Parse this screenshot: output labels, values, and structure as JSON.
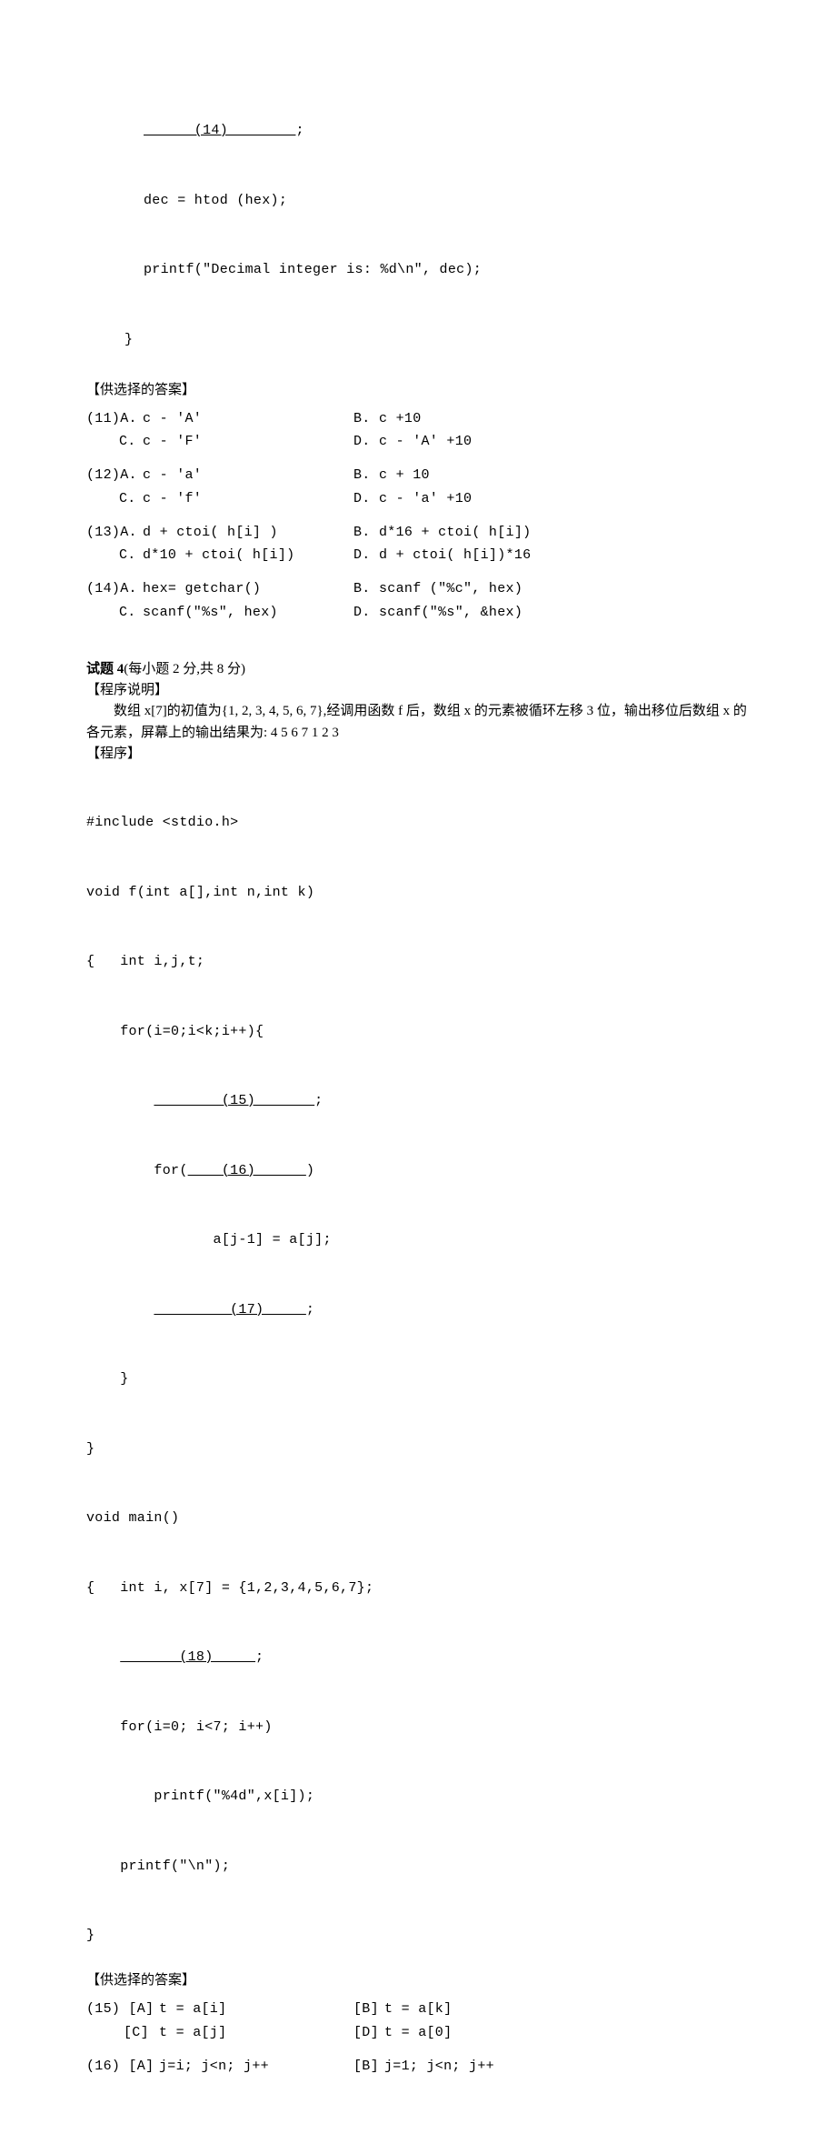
{
  "code_top": {
    "blank14": "      (14)        ",
    "blank14_semi": ";",
    "l2": "dec = htod (hex);",
    "l3": "printf(\"Decimal integer is: %d\\n\", dec);",
    "l4": "}"
  },
  "hdr_answers_top": "【供选择的答案】",
  "ans11": {
    "a_lbl": "(11)A.",
    "a": "c - 'A'",
    "b_lbl": "B.",
    "b": "c +10",
    "c_lbl": "C.",
    "c": "c - 'F'",
    "d_lbl": "D.",
    "d": "c - 'A'  +10"
  },
  "ans12": {
    "a_lbl": "(12)A.",
    "a": "c  - 'a'",
    "b_lbl": "B.",
    "b": "c + 10",
    "c_lbl": "C.",
    "c": "c - 'f'",
    "d_lbl": "D.",
    "d": "c - 'a'  +10"
  },
  "ans13": {
    "a_lbl": "(13)A.",
    "a": "d + ctoi( h[i] )",
    "b_lbl": "B.",
    "b": "d*16 + ctoi( h[i])",
    "c_lbl": "C.",
    "c": "d*10 + ctoi( h[i])",
    "d_lbl": "D.",
    "d": "d + ctoi( h[i])*16"
  },
  "ans14": {
    "a_lbl": "(14)A.",
    "a": "hex= getchar()",
    "b_lbl": "B.",
    "b": "scanf (\"%c\", hex)",
    "c_lbl": "C.",
    "c": "scanf(\"%s\", hex)",
    "d_lbl": "D.",
    "d": "scanf(\"%s\", &hex)"
  },
  "q4": {
    "title_bold": "试题 4",
    "title_rest": "(每小题 2 分,共 8 分)",
    "desc_head": "【程序说明】",
    "desc_body": "数组 x[7]的初值为{1, 2, 3, 4, 5, 6, 7},经调用函数 f 后，数组 x 的元素被循环左移 3 位，输出移位后数组 x 的各元素，屏幕上的输出结果为: 4  5  6  7  1  2  3",
    "prog_head": "【程序】"
  },
  "code4": {
    "l1": "#include <stdio.h>",
    "l2": "void f(int a[],int n,int k)",
    "l3": "{   int i,j,t;",
    "l4": "    for(i=0;i<k;i++){",
    "l5a": "        ",
    "b15": "        (15)       ",
    "l5b": ";",
    "l6a": "        for(",
    "b16": "    (16)      ",
    "l6b": ")",
    "l7": "               a[j-1] = a[j];",
    "l8a": "        ",
    "b17": "         (17)     ",
    "l8b": ";",
    "l9": "    }",
    "l10": "}",
    "l11": "void main()",
    "l12": "{   int i, x[7] = {1,2,3,4,5,6,7};",
    "l13a": "    ",
    "b18": "       (18)     ",
    "l13b": ";",
    "l14": "    for(i=0; i<7; i++)",
    "l15": "        printf(\"%4d\",x[i]);",
    "l16": "    printf(\"\\n\");",
    "l17": "}"
  },
  "hdr_answers_bottom": "【供选择的答案】",
  "ans15": {
    "a_lbl": "(15) [A]",
    "a": "t = a[i]",
    "b_lbl": "[B]",
    "b": "t = a[k]",
    "c_lbl": "[C]",
    "c": "t = a[j]",
    "d_lbl": "[D]",
    "d": "t = a[0]"
  },
  "ans16": {
    "a_lbl": "(16) [A]",
    "a": "j=i; j<n; j++",
    "b_lbl": "[B]",
    "b": "j=1; j<n; j++"
  }
}
